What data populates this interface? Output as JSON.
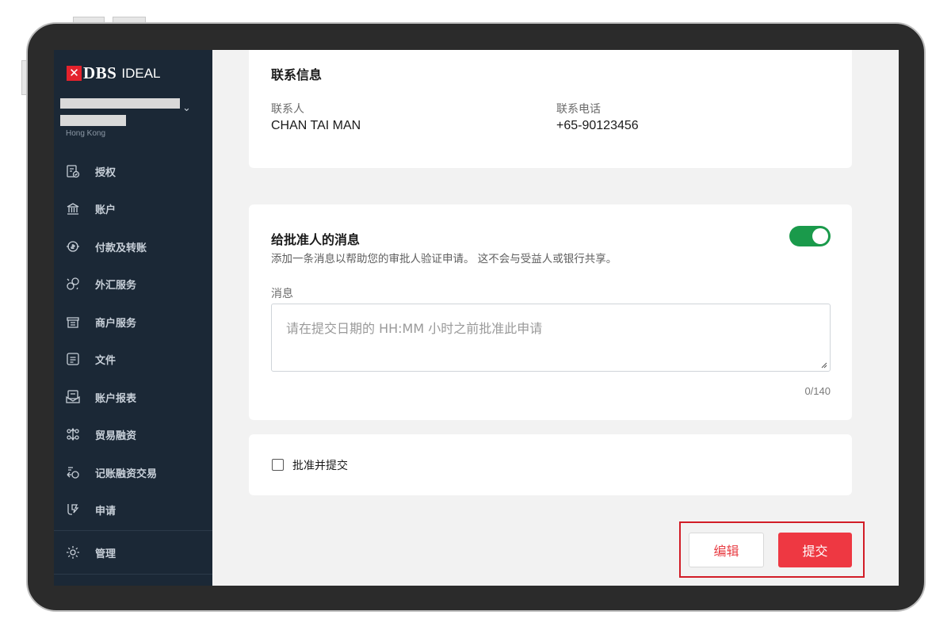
{
  "app": {
    "brand_mark": "✕",
    "brand_name": "DBS",
    "brand_product": "IDEAL",
    "account_region": "Hong Kong"
  },
  "sidebar": {
    "items": [
      {
        "label": "授权",
        "icon": "authorization-icon"
      },
      {
        "label": "账户",
        "icon": "bank-icon"
      },
      {
        "label": "付款及转账",
        "icon": "payment-icon"
      },
      {
        "label": "外汇服务",
        "icon": "fx-icon"
      },
      {
        "label": "商户服务",
        "icon": "merchant-icon"
      },
      {
        "label": "文件",
        "icon": "document-icon"
      },
      {
        "label": "账户报表",
        "icon": "statement-icon"
      },
      {
        "label": "贸易融资",
        "icon": "trade-finance-icon"
      },
      {
        "label": "记账融资交易",
        "icon": "receivable-finance-icon"
      },
      {
        "label": "申请",
        "icon": "application-icon"
      },
      {
        "label": "管理",
        "icon": "gear-icon"
      }
    ]
  },
  "contact": {
    "title": "联系信息",
    "person_label": "联系人",
    "person_value": "CHAN TAI MAN",
    "phone_label": "联系电话",
    "phone_value": "+65-90123456"
  },
  "message": {
    "title": "给批准人的消息",
    "toggle_on": true,
    "description": "添加一条消息以帮助您的审批人验证申请。 这不会与受益人或银行共享。",
    "field_label": "消息",
    "placeholder": "请在提交日期的 HH:MM 小时之前批准此申请",
    "counter": "0/140"
  },
  "approve": {
    "checkbox_label": "批准并提交",
    "checked": false
  },
  "actions": {
    "edit_label": "编辑",
    "submit_label": "提交"
  },
  "colors": {
    "sidebar_bg": "#1b2836",
    "brand_red": "#e4222c",
    "toggle_green": "#1a9a4b",
    "submit_red": "#ee3842",
    "highlight_red": "#d21d27"
  }
}
